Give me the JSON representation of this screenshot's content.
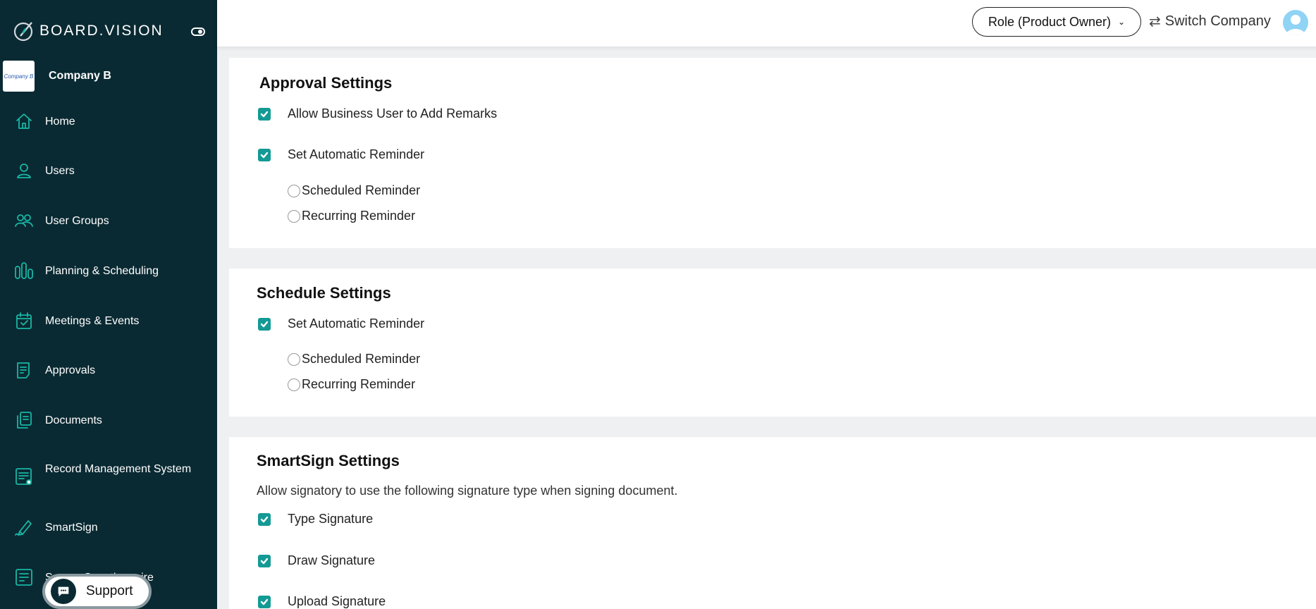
{
  "brand": {
    "name": "BOARD.VISION"
  },
  "company": {
    "logo_text": "Company B",
    "name": "Company B"
  },
  "sidebar": {
    "items": [
      {
        "label": "Home",
        "icon": "home-icon"
      },
      {
        "label": "Users",
        "icon": "user-icon"
      },
      {
        "label": "User Groups",
        "icon": "users-icon"
      },
      {
        "label": "Planning & Scheduling",
        "icon": "planning-icon"
      },
      {
        "label": "Meetings & Events",
        "icon": "calendar-icon"
      },
      {
        "label": "Approvals",
        "icon": "approvals-icon"
      },
      {
        "label": "Documents",
        "icon": "documents-icon"
      },
      {
        "label": "Record Management System",
        "icon": "records-icon"
      },
      {
        "label": "SmartSign",
        "icon": "pen-icon"
      },
      {
        "label": "Survey Questionnaire",
        "icon": "survey-icon"
      }
    ]
  },
  "support": {
    "label": "Support"
  },
  "topbar": {
    "role_label": "Role (Product Owner)",
    "switch_company_label": "Switch Company"
  },
  "approval": {
    "title": "Approval Settings",
    "allow_remarks": "Allow Business User to Add Remarks",
    "auto_reminder": "Set Automatic Reminder",
    "scheduled": "Scheduled Reminder",
    "recurring": "Recurring Reminder"
  },
  "schedule": {
    "title": "Schedule Settings",
    "auto_reminder": "Set Automatic Reminder",
    "scheduled": "Scheduled Reminder",
    "recurring": "Recurring Reminder"
  },
  "smartsign": {
    "title": "SmartSign Settings",
    "description": "Allow signatory to use the following signature type when signing document.",
    "type_sig": "Type Signature",
    "draw_sig": "Draw Signature",
    "upload_sig": "Upload Signature"
  },
  "colors": {
    "sidebar_bg": "#0a2a33",
    "accent": "#149a95",
    "icon_teal": "#19b6a4"
  }
}
